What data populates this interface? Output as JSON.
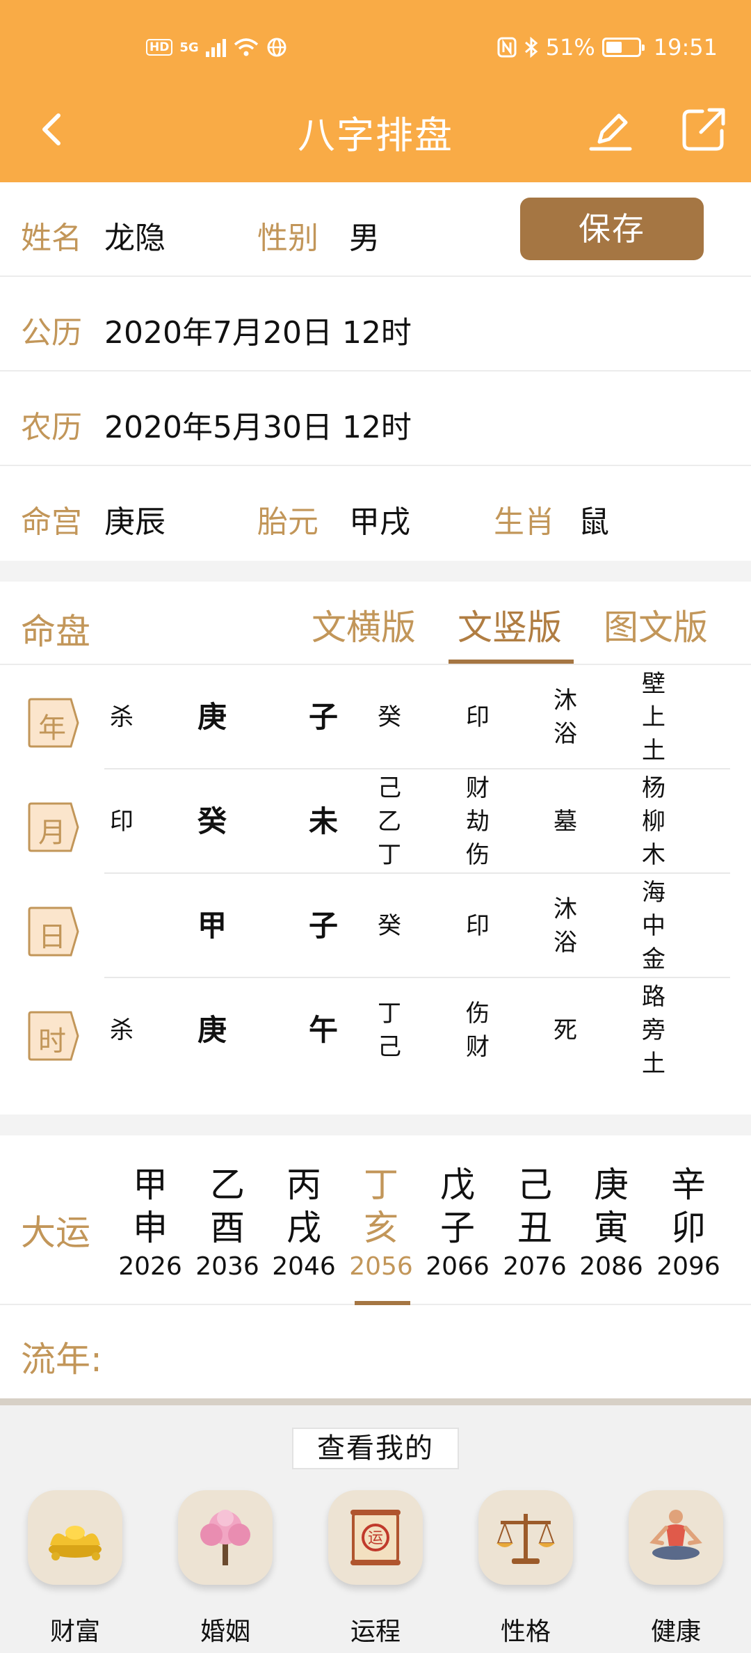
{
  "status": {
    "battery_percent": "51%",
    "time": "19:51",
    "hd": "HD",
    "net": "5G",
    "battery_level": 0.51
  },
  "header": {
    "title": "八字排盘"
  },
  "profile": {
    "name_label": "姓名",
    "name": "龙隐",
    "gender_label": "性别",
    "gender": "男",
    "save_label": "保存",
    "solar_label": "公历",
    "solar": "2020年7月20日 12时",
    "lunar_label": "农历",
    "lunar": "2020年5月30日 12时",
    "minggong_label": "命宫",
    "minggong": "庚辰",
    "taiyuan_label": "胎元",
    "taiyuan": "甲戌",
    "shengxiao_label": "生肖",
    "shengxiao": "鼠"
  },
  "chart": {
    "title": "命盘",
    "tabs": [
      "文横版",
      "文竖版",
      "图文版"
    ],
    "active_tab": "文竖版",
    "pillars": [
      {
        "label": "年",
        "shishen": "杀",
        "stem": "庚",
        "branch": "子",
        "canggan": [
          "癸"
        ],
        "canggan_shishen": [
          "印"
        ],
        "changsheng": [
          "沐",
          "浴"
        ],
        "nayin": [
          "壁",
          "上",
          "土"
        ]
      },
      {
        "label": "月",
        "shishen": "印",
        "stem": "癸",
        "branch": "未",
        "canggan": [
          "己",
          "乙",
          "丁"
        ],
        "canggan_shishen": [
          "财",
          "劫",
          "伤"
        ],
        "changsheng": [
          "墓"
        ],
        "nayin": [
          "杨",
          "柳",
          "木"
        ]
      },
      {
        "label": "日",
        "shishen": "",
        "stem": "甲",
        "branch": "子",
        "canggan": [
          "癸"
        ],
        "canggan_shishen": [
          "印"
        ],
        "changsheng": [
          "沐",
          "浴"
        ],
        "nayin": [
          "海",
          "中",
          "金"
        ]
      },
      {
        "label": "时",
        "shishen": "杀",
        "stem": "庚",
        "branch": "午",
        "canggan": [
          "丁",
          "己"
        ],
        "canggan_shishen": [
          "伤",
          "财"
        ],
        "changsheng": [
          "死"
        ],
        "nayin": [
          "路",
          "旁",
          "土"
        ]
      }
    ]
  },
  "dayun": {
    "label": "大运",
    "items": [
      {
        "stem": "甲",
        "branch": "申",
        "year": "2026"
      },
      {
        "stem": "乙",
        "branch": "酉",
        "year": "2036"
      },
      {
        "stem": "丙",
        "branch": "戌",
        "year": "2046"
      },
      {
        "stem": "丁",
        "branch": "亥",
        "year": "2056"
      },
      {
        "stem": "戊",
        "branch": "子",
        "year": "2066"
      },
      {
        "stem": "己",
        "branch": "丑",
        "year": "2076"
      },
      {
        "stem": "庚",
        "branch": "寅",
        "year": "2086"
      },
      {
        "stem": "辛",
        "branch": "卯",
        "year": "2096"
      }
    ],
    "active_index": 3
  },
  "liunian": {
    "label": "流年:"
  },
  "bottom": {
    "title": "查看我的",
    "features": [
      {
        "label": "财富",
        "icon": "gold-ingot-icon"
      },
      {
        "label": "婚姻",
        "icon": "blossom-tree-icon"
      },
      {
        "label": "运程",
        "icon": "fortune-scroll-icon"
      },
      {
        "label": "性格",
        "icon": "balance-scale-icon"
      },
      {
        "label": "健康",
        "icon": "meditation-icon"
      }
    ]
  },
  "colors": {
    "header": "#f9ab46",
    "accent": "#c29659",
    "button": "#a57643"
  }
}
